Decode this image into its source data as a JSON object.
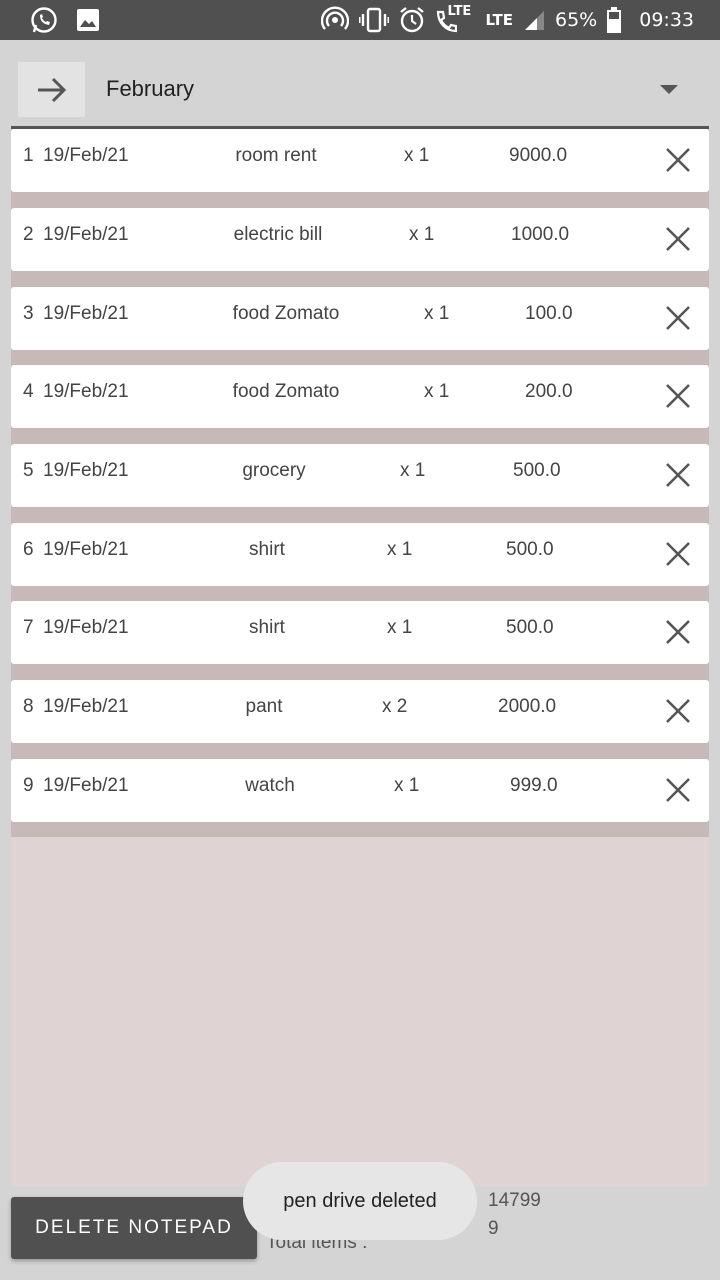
{
  "status_bar": {
    "battery": "65%",
    "time": "09:33",
    "network_1": "LTE",
    "network_2": "LTE",
    "left_icons": [
      "whatsapp-icon",
      "image-icon"
    ],
    "right_icons": [
      "hotspot-icon",
      "vibrate-icon",
      "alarm-icon",
      "volte-call-icon",
      "signal-icon",
      "battery-icon"
    ]
  },
  "header": {
    "month": "February",
    "arrow_icon": "arrow-right-icon",
    "dropdown_icon": "caret-down-icon"
  },
  "items": [
    {
      "index": "1",
      "date": "19/Feb/21",
      "name": "room rent",
      "qty": "x 1",
      "amount": "9000.0"
    },
    {
      "index": "2",
      "date": "19/Feb/21",
      "name": "electric bill",
      "qty": "x 1",
      "amount": "1000.0"
    },
    {
      "index": "3",
      "date": "19/Feb/21",
      "name": "food Zomato",
      "qty": "x 1",
      "amount": "100.0"
    },
    {
      "index": "4",
      "date": "19/Feb/21",
      "name": "food Zomato",
      "qty": "x 1",
      "amount": "200.0"
    },
    {
      "index": "5",
      "date": "19/Feb/21",
      "name": "grocery",
      "qty": "x 1",
      "amount": "500.0"
    },
    {
      "index": "6",
      "date": "19/Feb/21",
      "name": "shirt",
      "qty": "x 1",
      "amount": "500.0"
    },
    {
      "index": "7",
      "date": "19/Feb/21",
      "name": "shirt",
      "qty": "x 1",
      "amount": "500.0"
    },
    {
      "index": "8",
      "date": "19/Feb/21",
      "name": "pant",
      "qty": "x 2",
      "amount": "2000.0"
    },
    {
      "index": "9",
      "date": "19/Feb/21",
      "name": "watch",
      "qty": "x 1",
      "amount": "999.0"
    }
  ],
  "footer": {
    "delete_label": "DELETE NOTEPAD",
    "total_amount_label": "T",
    "total_amount": "14799",
    "total_items_label": "Total items :",
    "total_items": "9"
  },
  "toast": {
    "message": "pen drive deleted"
  },
  "colors": {
    "status_bar": "#505050",
    "list_background": "#c6b9b8",
    "empty_area": "#dfd3d3",
    "button": "#505050"
  }
}
